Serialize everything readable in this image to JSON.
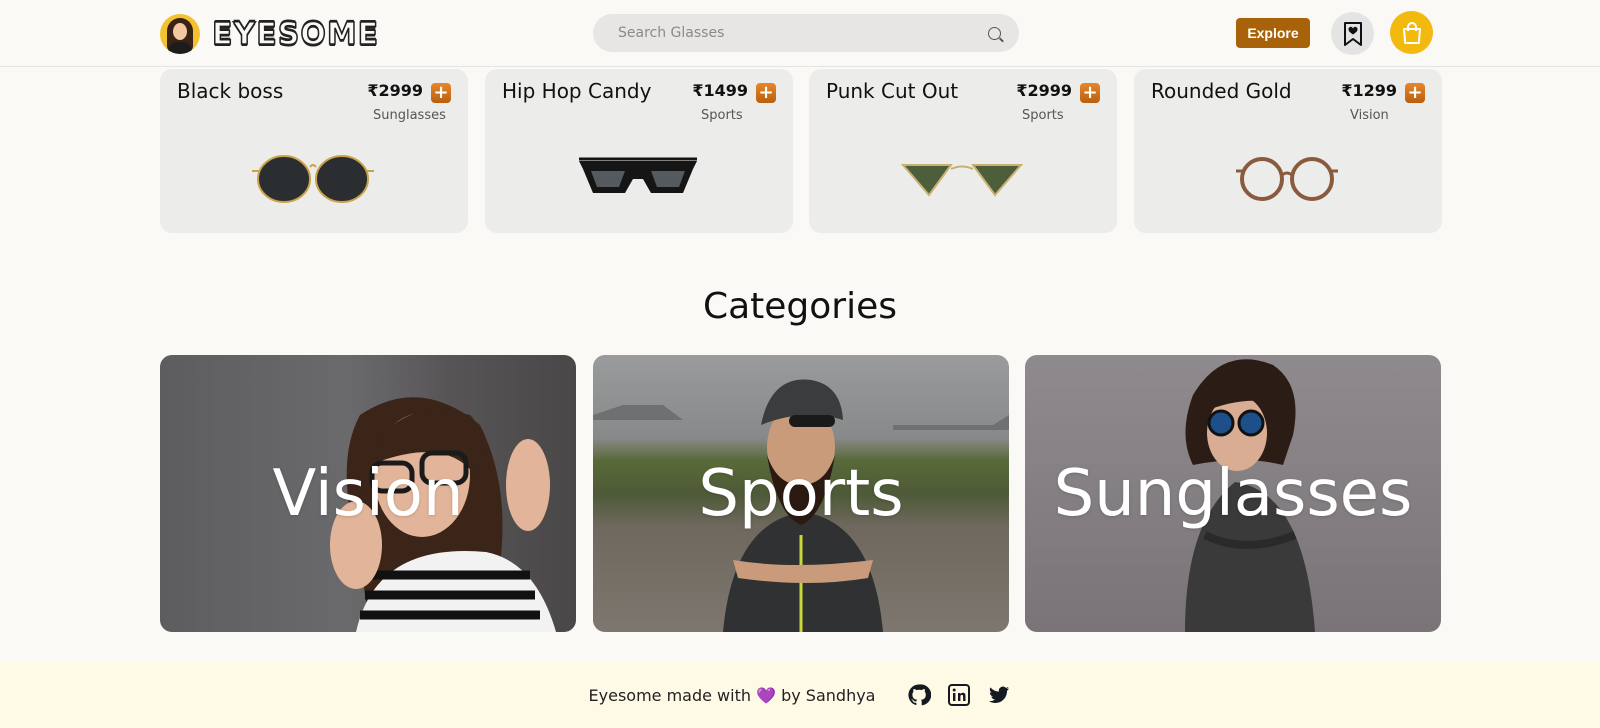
{
  "header": {
    "logo_text": "EYESOME",
    "search_placeholder": "Search Glasses",
    "explore_label": "Explore"
  },
  "products": [
    {
      "name": "Black boss",
      "price": "₹2999",
      "category": "Sunglasses",
      "add": "+"
    },
    {
      "name": "Hip Hop Candy",
      "price": "₹1499",
      "category": "Sports",
      "add": "+"
    },
    {
      "name": "Punk Cut Out",
      "price": "₹2999",
      "category": "Sports",
      "add": "+"
    },
    {
      "name": "Rounded Gold",
      "price": "₹1299",
      "category": "Vision",
      "add": "+"
    }
  ],
  "categories_title": "Categories",
  "categories": [
    {
      "label": "Vision"
    },
    {
      "label": "Sports"
    },
    {
      "label": "Sunglasses"
    }
  ],
  "footer": {
    "text": "Eyesome made with 💜 by Sandhya"
  },
  "colors": {
    "accent": "#a8620a",
    "cart": "#f2b90f",
    "footer_bg": "#fffae6"
  },
  "icons": [
    "search-icon",
    "bookmark-heart-icon",
    "shopping-bag-icon",
    "github-icon",
    "linkedin-icon",
    "twitter-icon"
  ]
}
